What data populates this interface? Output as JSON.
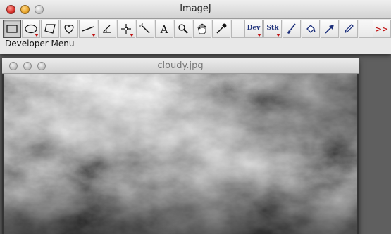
{
  "main_window": {
    "title": "ImageJ",
    "status_text": "Developer Menu"
  },
  "toolbar": {
    "selected_tool": "rectangle-tool",
    "menu_labels": {
      "dev": "Dev",
      "stk": "Stk",
      "more": ">>"
    }
  },
  "image_window": {
    "title": "cloudy.jpg"
  },
  "colors": {
    "menu_text": "#1c2f7a",
    "dropdown_triangle": "#c01010"
  }
}
